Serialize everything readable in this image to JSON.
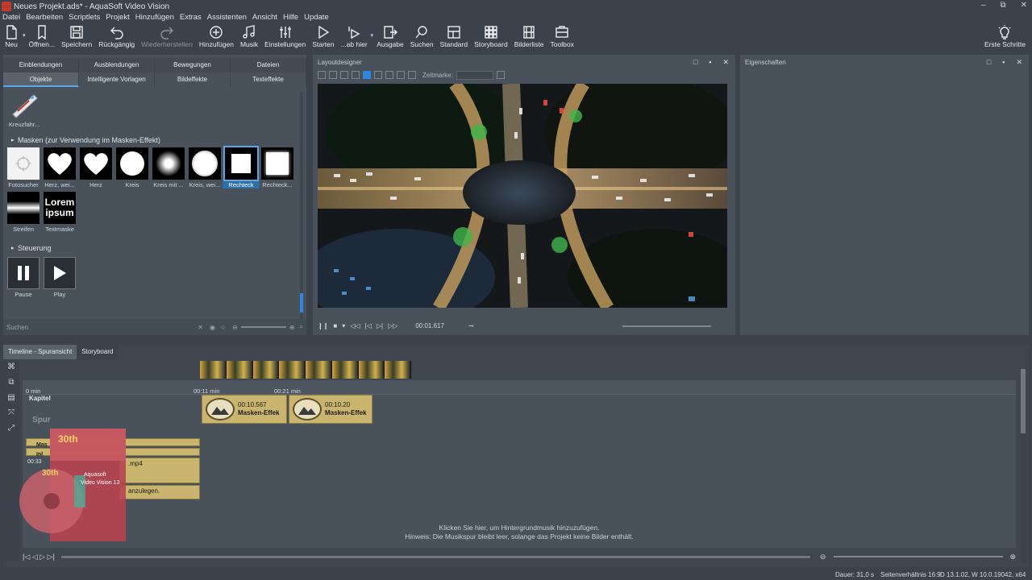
{
  "window": {
    "title": "Neues Projekt.ads* - AquaSoft Video Vision",
    "controls": [
      "–",
      "⧉",
      "✕"
    ]
  },
  "menu": [
    "Datei",
    "Bearbeiten",
    "Scriptlets",
    "Projekt",
    "Hinzufügen",
    "Extras",
    "Assistenten",
    "Ansicht",
    "Hilfe",
    "Update"
  ],
  "toolbar": {
    "buttons": [
      {
        "label": "Neu",
        "icon": "new-file-icon"
      },
      {
        "label": "Öffnen...",
        "icon": "open-icon"
      },
      {
        "label": "Speichern",
        "icon": "save-icon"
      },
      {
        "label": "Rückgängig",
        "icon": "undo-icon"
      },
      {
        "label": "Wiederherstellen",
        "icon": "redo-icon"
      },
      {
        "label": "Hinzufügen",
        "icon": "add-circle-icon"
      },
      {
        "label": "Musik",
        "icon": "music-icon"
      },
      {
        "label": "Einstellungen",
        "icon": "settings-sliders-icon"
      },
      {
        "label": "Starten",
        "icon": "play-icon"
      },
      {
        "label": "...ab hier",
        "icon": "play-from-here-icon"
      },
      {
        "label": "Ausgabe",
        "icon": "output-icon"
      },
      {
        "label": "Suchen",
        "icon": "search-icon"
      },
      {
        "label": "Standard",
        "icon": "standard-layout-icon"
      },
      {
        "label": "Storyboard",
        "icon": "storyboard-icon"
      },
      {
        "label": "Bilderliste",
        "icon": "image-list-icon"
      },
      {
        "label": "Toolbox",
        "icon": "toolbox-icon"
      }
    ],
    "right_button": {
      "label": "Erste Schritte",
      "icon": "lightbulb-icon"
    }
  },
  "left_panel": {
    "tabs_row1": [
      "Einblendungen",
      "Ausblendungen",
      "Bewegungen",
      "Dateien"
    ],
    "tabs_row2": [
      "Objekte",
      "Intelligente Vorlagen",
      "Bildeffekte",
      "Texteffekte"
    ],
    "active_tab": "Objekte",
    "top_item": {
      "label": "Kreuzfahr..."
    },
    "masks_section": {
      "title": "Masken (zur Verwendung im Masken-Effekt)",
      "items": [
        {
          "label": "Fotosucher"
        },
        {
          "label": "Herz, wei..."
        },
        {
          "label": "Herz"
        },
        {
          "label": "Kreis"
        },
        {
          "label": "Kreis mit ..."
        },
        {
          "label": "Kreis, wei..."
        },
        {
          "label": "Rechteck"
        },
        {
          "label": "Rechteck..."
        },
        {
          "label": "Streifen"
        },
        {
          "label": "Textmaske"
        }
      ],
      "selected": "Rechteck",
      "textmask_text": "Lorem ipsum"
    },
    "control_section": {
      "title": "Steuerung",
      "items": [
        {
          "label": "Pause"
        },
        {
          "label": "Play"
        }
      ]
    },
    "search_placeholder": "Suchen"
  },
  "layout_designer": {
    "title": "Layoutdesigner",
    "zeitmarke_label": "Zeitmarke:",
    "time": "00:01.617"
  },
  "properties": {
    "title": "Eigenschaften"
  },
  "timeline": {
    "tabs": [
      "Timeline - Spuransicht",
      "Storyboard"
    ],
    "ruler_labels": [
      "0 min",
      "00:11 min",
      "00:21 min"
    ],
    "tracks": {
      "chapter": "Kapitel",
      "track": "Spur",
      "masters_short": "Mas",
      "inline_short": "Inl",
      "time_short": "00:33",
      "mp4_label": ".mp4",
      "add_hint": "anzulegen."
    },
    "clips": [
      {
        "time": "00:10.567",
        "label": "Masken-Effek"
      },
      {
        "time": "00:10.20",
        "label": "Masken-Effek"
      }
    ],
    "music_hint_line1": "Klicken Sie hier, um Hintergrundmusik hinzuzufügen.",
    "music_hint_line2": "Hinweis: Die Musikspur bleibt leer, solange das Projekt keine Bilder enthält."
  },
  "product_box": {
    "badge": "30th",
    "brand": "Aquasoft",
    "name": "Video Vision 13"
  },
  "status": {
    "duration": "Dauer: 31,0 s",
    "aspect": "Seitenverhältnis 16:9",
    "version": "D 13.1.02, W 10.0.19042, x64"
  },
  "colors": {
    "accent": "#2e86de",
    "panel": "#49515a",
    "background": "#3b424b",
    "clip": "#c9b56e"
  }
}
